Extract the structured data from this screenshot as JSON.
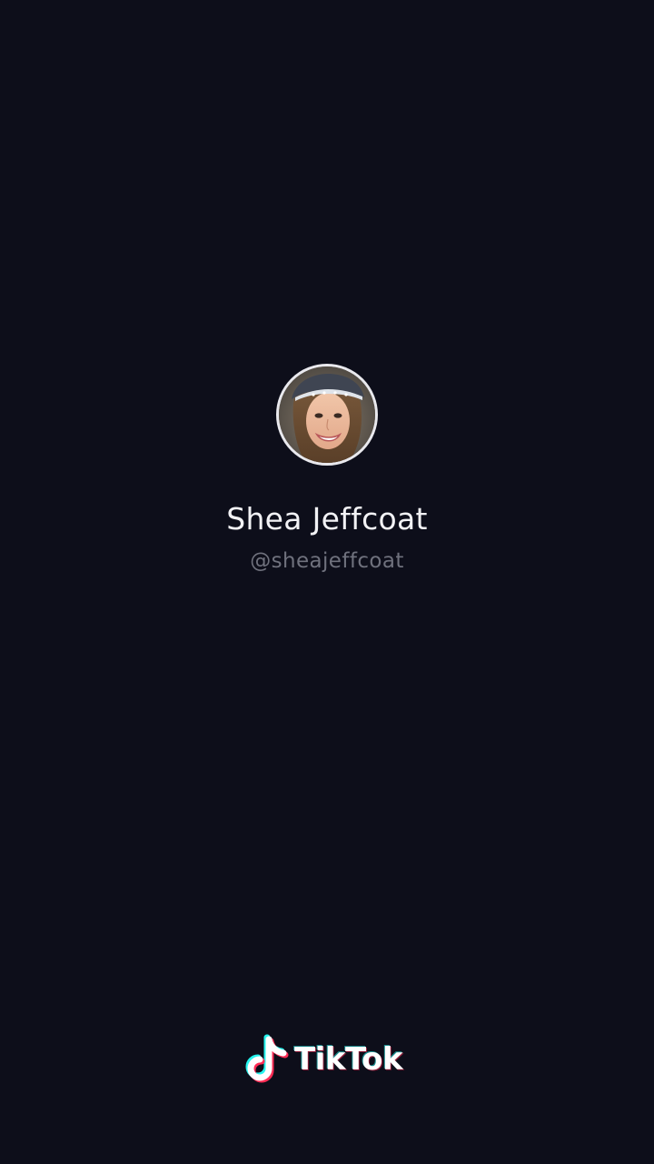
{
  "profile": {
    "display_name": "Shea Jeffcoat",
    "username": "@sheajeffcoat",
    "avatar": "profile-photo"
  },
  "branding": {
    "logo_icon": "tiktok-note-icon",
    "name": "TikTok"
  },
  "colors": {
    "background": "#0d0e1a",
    "name_text": "#f2f2f5",
    "username_text": "#6f717d",
    "brand_cyan": "#25f4ee",
    "brand_red": "#fe2c55"
  }
}
